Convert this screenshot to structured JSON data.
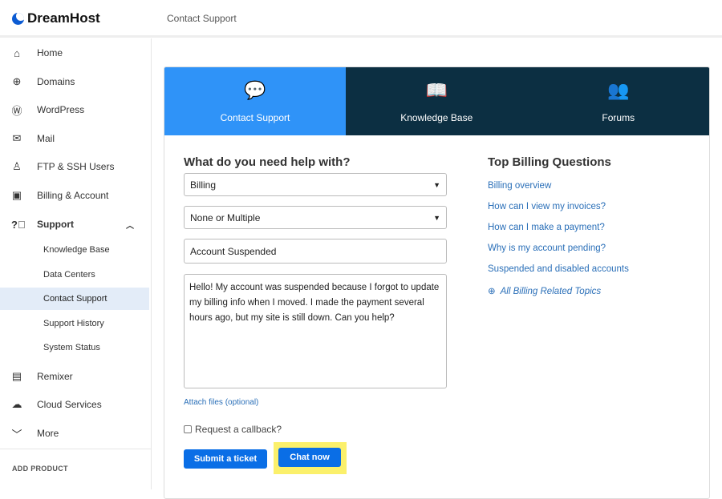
{
  "header": {
    "logo": "DreamHost",
    "breadcrumb": "Contact Support"
  },
  "sidebar": {
    "items": [
      {
        "label": "Home",
        "icon": "home-icon"
      },
      {
        "label": "Domains",
        "icon": "globe-icon"
      },
      {
        "label": "WordPress",
        "icon": "wordpress-icon"
      },
      {
        "label": "Mail",
        "icon": "mail-icon"
      },
      {
        "label": "FTP & SSH Users",
        "icon": "user-icon"
      },
      {
        "label": "Billing & Account",
        "icon": "wallet-icon"
      },
      {
        "label": "Support",
        "icon": "help-icon"
      },
      {
        "label": "Remixer",
        "icon": "remixer-icon"
      },
      {
        "label": "Cloud Services",
        "icon": "cloud-icon"
      },
      {
        "label": "More",
        "icon": "chevron-down-icon"
      }
    ],
    "support_sub": [
      "Knowledge Base",
      "Data Centers",
      "Contact Support",
      "Support History",
      "System Status"
    ],
    "add_product": "ADD PRODUCT"
  },
  "tabs": [
    {
      "label": "Contact Support",
      "active": true
    },
    {
      "label": "Knowledge Base"
    },
    {
      "label": "Forums"
    }
  ],
  "form": {
    "heading": "What do you need help with?",
    "category": "Billing",
    "subcategory": "None or Multiple",
    "subject": "Account Suspended",
    "message": "Hello! My account was suspended because I forgot to update my billing info when I moved. I made the payment several hours ago, but my site is still down. Can you help?",
    "attach": "Attach files (optional)",
    "callback": "Request a callback?",
    "callback_checked": false,
    "submit": "Submit a ticket",
    "chat": "Chat now"
  },
  "questions": {
    "heading": "Top Billing Questions",
    "items": [
      "Billing overview",
      "How can I view my invoices?",
      "How can I make a payment?",
      "Why is my account pending?",
      "Suspended and disabled accounts"
    ],
    "all": "All Billing Related Topics"
  },
  "colors": {
    "accent": "#2f93f8",
    "dark_tab": "#0c2f42",
    "button": "#0a6ee6",
    "highlight": "#fbf06b"
  }
}
